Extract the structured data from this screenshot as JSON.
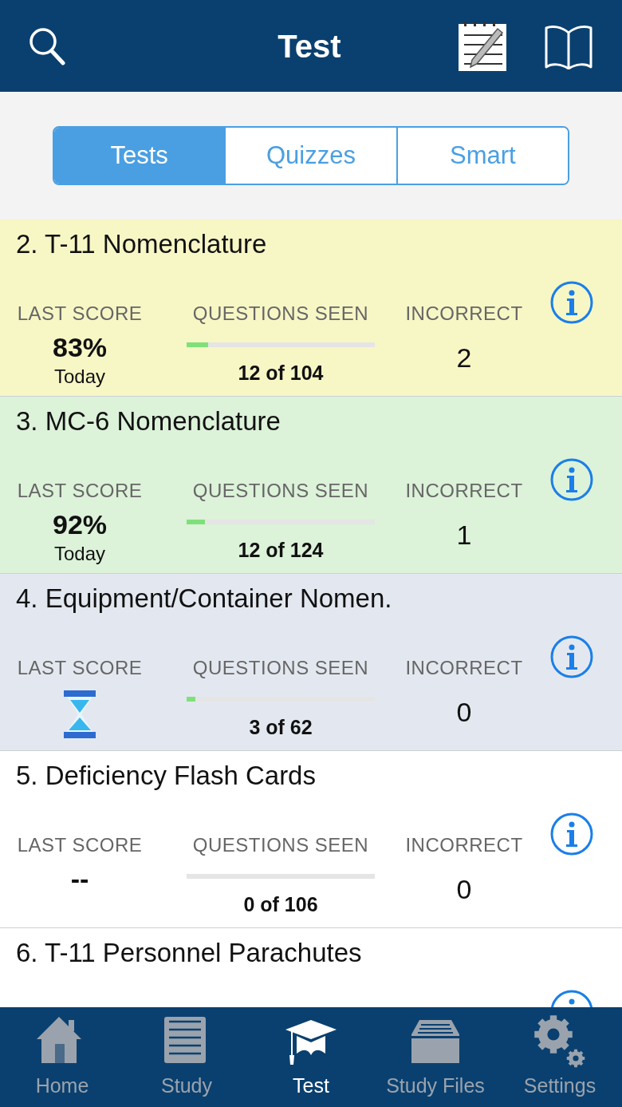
{
  "header": {
    "title": "Test"
  },
  "segments": [
    {
      "label": "Tests",
      "selected": true
    },
    {
      "label": "Quizzes",
      "selected": false
    },
    {
      "label": "Smart",
      "selected": false
    }
  ],
  "tests": [
    {
      "title": "2. T-11 Nomenclature",
      "color": "#f7f6c5",
      "score_label": "LAST SCORE",
      "kind": "score",
      "score": "83%",
      "score_date": "Today",
      "seen_label": "QUESTIONS SEEN",
      "level": 0.115,
      "seen": "12 of 104",
      "incorrect_label": "INCORRECT",
      "incorrect": "2"
    },
    {
      "title": "3. MC-6 Nomenclature",
      "color": "#dcf2d9",
      "score_label": "LAST SCORE",
      "kind": "score",
      "score": "92%",
      "score_date": "Today",
      "seen_label": "QUESTIONS SEEN",
      "level": 0.097,
      "seen": "12 of 124",
      "incorrect_label": "INCORRECT",
      "incorrect": "1"
    },
    {
      "title": "4. Equipment/Container Nomen.",
      "color": "#e3e8f0",
      "score_label": "LAST SCORE",
      "kind": "pending",
      "seen_label": "QUESTIONS SEEN",
      "level": 0.048,
      "seen": "3 of 62",
      "incorrect_label": "INCORRECT",
      "incorrect": "0"
    },
    {
      "title": "5. Deficiency Flash Cards",
      "color": "#ffffff",
      "score_label": "LAST SCORE",
      "kind": "none",
      "score": "--",
      "seen_label": "QUESTIONS SEEN",
      "level": 0,
      "seen": "0 of 106",
      "incorrect_label": "INCORRECT",
      "incorrect": "0"
    },
    {
      "title": "6. T-11 Personnel Parachutes",
      "color": "#ffffff"
    }
  ],
  "tabbar": [
    {
      "label": "Home",
      "kind": "home",
      "selected": false
    },
    {
      "label": "Study",
      "kind": "notes",
      "selected": false
    },
    {
      "label": "Test",
      "kind": "cap",
      "selected": true
    },
    {
      "label": "Study Files",
      "kind": "drawer",
      "selected": false
    },
    {
      "label": "Settings",
      "kind": "gears",
      "selected": false
    }
  ]
}
